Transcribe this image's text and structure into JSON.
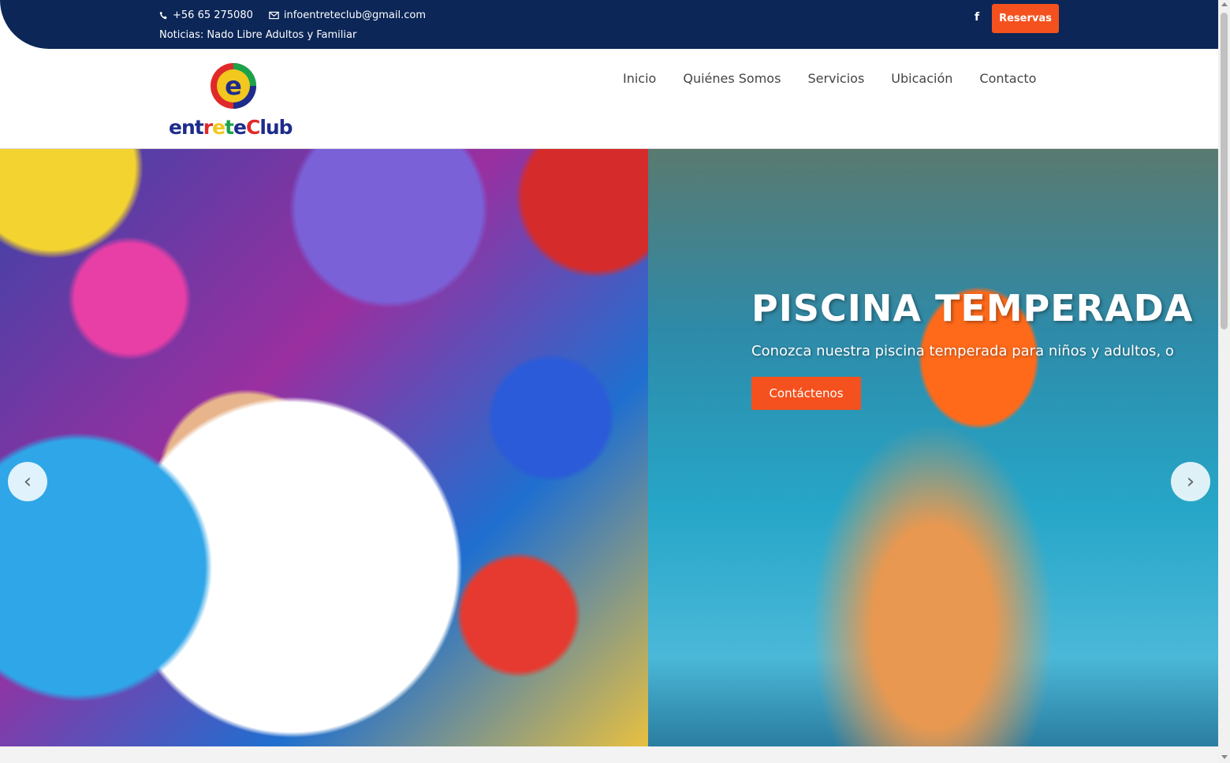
{
  "topbar": {
    "phone": "+56 65 275080",
    "email": "infoentreteclub@gmail.com",
    "news": "Noticias: Nado Libre Adultos y Familiar",
    "reservas_label": "Reservas",
    "facebook_glyph": "f"
  },
  "logo": {
    "letter": "e",
    "word_parts": [
      {
        "text": "ent",
        "color": "#1d2c8c"
      },
      {
        "text": "r",
        "color": "#e02a2a"
      },
      {
        "text": "e",
        "color": "#f2c71e"
      },
      {
        "text": "t",
        "color": "#1aa34a"
      },
      {
        "text": "e",
        "color": "#1d2c8c"
      },
      {
        "text": "C",
        "color": "#e02a2a"
      },
      {
        "text": "lub",
        "color": "#1d2c8c"
      }
    ]
  },
  "nav": {
    "items": [
      "Inicio",
      "Quiénes Somos",
      "Servicios",
      "Ubicación",
      "Contacto"
    ]
  },
  "hero": {
    "title": "PISCINA TEMPERADA",
    "subtitle": "Conozca nuestra piscina temperada para niños y adultos, o",
    "cta_label": "Contáctenos",
    "prev_glyph": "‹",
    "next_glyph": "›"
  },
  "colors": {
    "navy": "#0b2657",
    "accent": "#f4511e"
  }
}
